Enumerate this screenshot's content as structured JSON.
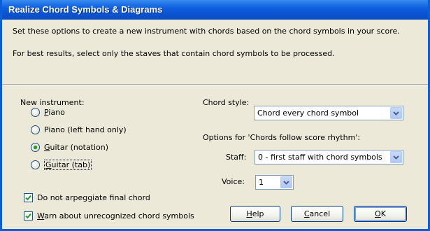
{
  "dialog": {
    "title": "Realize Chord Symbols & Diagrams",
    "description_1": "Set these options to create a new instrument with chords based on the chord symbols in your score.",
    "description_2": "For best results, select only the staves that contain chord symbols to be processed."
  },
  "new_instrument": {
    "label": "New instrument:",
    "options": [
      {
        "label": "Piano",
        "accel": "P",
        "rest": "iano",
        "selected": false
      },
      {
        "label": "Piano (left hand only)",
        "accel": "",
        "rest": "Piano (left hand only)",
        "selected": false
      },
      {
        "label": "Guitar (notation)",
        "accel": "G",
        "rest": "uitar (notation)",
        "selected": true
      },
      {
        "label": "Guitar (tab)",
        "accel": "G",
        "rest": "uitar (tab)",
        "selected": false
      }
    ]
  },
  "checkboxes": [
    {
      "label": "Do not arpeggiate final chord",
      "checked": true
    },
    {
      "label": "Warn about unrecognized chord symbols",
      "accel": "W",
      "rest": "arn about unrecognized chord symbols",
      "checked": true
    }
  ],
  "chord_style": {
    "label": "Chord style:",
    "value": "Chord every chord symbol"
  },
  "rhythm_options": {
    "label": "Options for 'Chords follow score rhythm':",
    "staff_label": "Staff:",
    "staff_value": "0 - first staff with chord symbols",
    "voice_label": "Voice:",
    "voice_value": "1"
  },
  "buttons": {
    "help": {
      "accel": "H",
      "rest": "elp"
    },
    "cancel": {
      "accel": "C",
      "rest": "ancel"
    },
    "ok": {
      "accel": "O",
      "rest": "K"
    }
  },
  "colors": {
    "titlebar": "#0a52cf",
    "dialog_bg": "#ece9d8",
    "radio_selected": "#21a121",
    "check_mark": "#21a121"
  }
}
